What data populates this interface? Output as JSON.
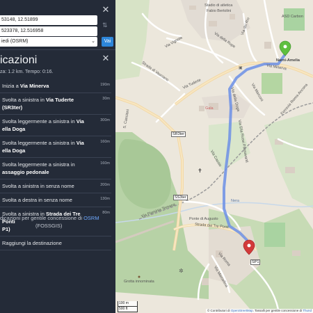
{
  "routing": {
    "from_value": "53148, 12.51899",
    "to_value": "523378, 12.516958",
    "profile": "iedi (OSRM)",
    "go_label": "Vai"
  },
  "itinerary": {
    "title": "icazioni",
    "summary": "za: 1.2 km. Tempo: 0:16.",
    "steps": [
      {
        "pre": "Inizia a ",
        "bold": "Via Minerva",
        "dist": "190m"
      },
      {
        "pre": "Svolta a sinistra in ",
        "bold": "Via Tuderte (SR3ter)",
        "dist": "30m"
      },
      {
        "pre": "Svolta leggermente a sinistra in ",
        "bold": "Via",
        "line2_bold": "ella Doga",
        "dist": "300m"
      },
      {
        "pre": "Svolta leggermente a sinistra in ",
        "bold": "Via",
        "line2_bold": "ella Doga",
        "dist": "160m"
      },
      {
        "pre": "Svolta leggermente a sinistra in",
        "line2_bold": "assaggio pedonale",
        "dist": "160m"
      },
      {
        "pre": "Svolta a sinistra in senza nome",
        "dist": "200m"
      },
      {
        "pre": "Svolta a destra in senza nome",
        "dist": "130m"
      },
      {
        "pre": "Svolta a sinistra in ",
        "bold": "Strada dei Tre Ponti",
        "line2_bold": "P1)",
        "dist": "80m"
      },
      {
        "pre": "Raggiungi la destinazione",
        "dist": ""
      }
    ],
    "credit_pre": "dicazioni per gentile concessione di ",
    "credit_link": "OSRM",
    "credit_paren": "(FOSSGIS)"
  },
  "map": {
    "labels": {
      "stadio": "Stadio di atletica",
      "stadio2": "Fabio Bertolini",
      "asd": "ASD Carbon",
      "narni_amelia": "Narni-Amelia",
      "via_vignola": "Via Vignola",
      "via_della_rupe": "Via della Rupe",
      "via_del_rio": "Via del Rio",
      "via_tuderte": "Via Tuderte",
      "via_minerva": "Via Minerva",
      "strada_di_vasciano": "Strada di Vasciano",
      "via_della_doga": "Via della Doga",
      "gala": "Gala",
      "via_marconi": "Via Marconi",
      "via_elia_rossi": "Via Elia Rossi Passavanti",
      "via_cassio": "Via Cassio",
      "s_casciani": "S. Casciani",
      "ponte_augusto": "Ponte di Augusto",
      "strada_tre_ponti": "Strada dei Tre Ponti",
      "via_flaminia": "Via Flaminia Ternana",
      "nera": "Nera",
      "grotta": "Grotta innominata",
      "via_mazzini": "Via Marcellina",
      "ferrovia": "Ferrovia Roma-Ancona",
      "via_roma": "Via Roma",
      "sr3ter": "SR3ter",
      "ss3ter": "SS3ter",
      "sp1": "SP1"
    },
    "scale_m": "100 m",
    "scale_ft": "500 ft",
    "attribution_pre": "© Contributori di ",
    "attribution_osm": "OpenStreetMap",
    "attribution_mid": ". Tassalli per gentile concessione di ",
    "attribution_end": "Thund"
  },
  "colors": {
    "panel_bg": "#242b38",
    "route": "#6c8fe6",
    "start_marker": "#5fbf3f",
    "end_marker": "#d23a3a",
    "forest": "#b7d2a6",
    "forest_dark": "#9fc28c",
    "link": "#6ea8fe"
  }
}
